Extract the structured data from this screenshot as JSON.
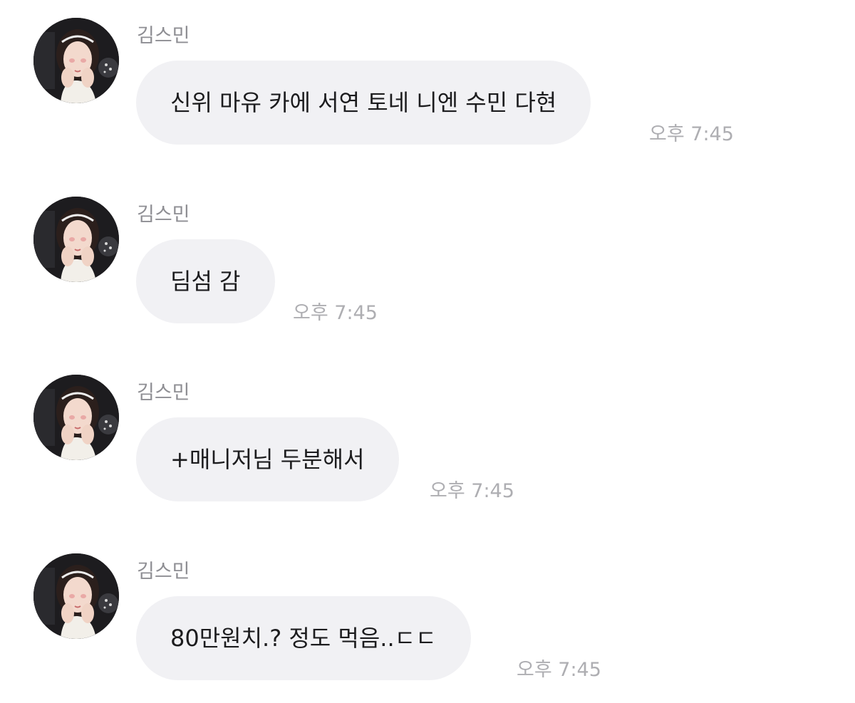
{
  "chat": {
    "messages": [
      {
        "sender": "김스민",
        "text": "신위 마유 카에 서연 토네 니엔 수민 다현",
        "time": "오후 7:45",
        "avatar_icon": "profile-photo"
      },
      {
        "sender": "김스민",
        "text": "딤섬 감",
        "time": "오후 7:45",
        "avatar_icon": "profile-photo"
      },
      {
        "sender": "김스민",
        "text": "+매니저님 두분해서",
        "time": "오후 7:45",
        "avatar_icon": "profile-photo"
      },
      {
        "sender": "김스민",
        "text": "80만원치.? 정도 먹음..ㄷㄷ",
        "time": "오후 7:45",
        "avatar_icon": "profile-photo"
      }
    ]
  },
  "colors": {
    "bubble_background": "#f1f1f4",
    "sender_text": "#8e8e93",
    "time_text": "#aeaeb2",
    "message_text": "#1c1c1e"
  }
}
